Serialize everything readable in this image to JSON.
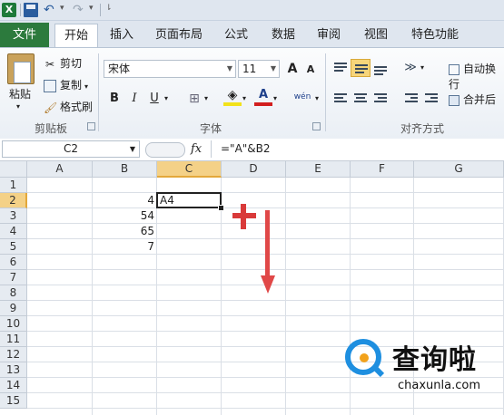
{
  "quick_access": {
    "app_icon": "X",
    "undo_icon": "undo-icon",
    "redo_icon": "redo-icon"
  },
  "tabs": [
    {
      "label": "文件"
    },
    {
      "label": "开始"
    },
    {
      "label": "插入"
    },
    {
      "label": "页面布局"
    },
    {
      "label": "公式"
    },
    {
      "label": "数据"
    },
    {
      "label": "审阅"
    },
    {
      "label": "视图"
    },
    {
      "label": "特色功能"
    }
  ],
  "ribbon": {
    "clipboard": {
      "paste_label": "粘贴",
      "cut_label": "剪切",
      "copy_label": "复制",
      "format_painter_label": "格式刷",
      "group_label": "剪贴板"
    },
    "font": {
      "font_name": "宋体",
      "font_size": "11",
      "grow_label": "A",
      "shrink_label": "A",
      "bold_label": "B",
      "italic_label": "I",
      "underline_label": "U",
      "font_color_label": "A",
      "wen_label": "wén",
      "group_label": "字体"
    },
    "alignment": {
      "wrap_label": "自动换行",
      "merge_label": "合并后",
      "group_label": "对齐方式"
    }
  },
  "formula_bar": {
    "name_box": "C2",
    "fx_label": "fx",
    "formula": "=\"A\"&B2"
  },
  "sheet": {
    "columns": [
      "A",
      "B",
      "C",
      "D",
      "E",
      "F",
      "G"
    ],
    "rows": [
      "1",
      "2",
      "3",
      "4",
      "5",
      "6",
      "7",
      "8",
      "9",
      "10",
      "11",
      "12",
      "13",
      "14",
      "15"
    ],
    "cells": {
      "B2": "4",
      "B3": "54",
      "B4": "65",
      "B5": "7",
      "C2": "A4"
    },
    "selected_cell": "C2",
    "selected_column": "C",
    "selected_row": "2"
  },
  "annotation_colors": {
    "plus": "#d93a3a",
    "arrow": "#e04848"
  },
  "watermark": {
    "title": "查询啦",
    "url": "chaxunla.com",
    "brand_color": "#1e8fe0",
    "accent_color": "#f2a21b"
  }
}
